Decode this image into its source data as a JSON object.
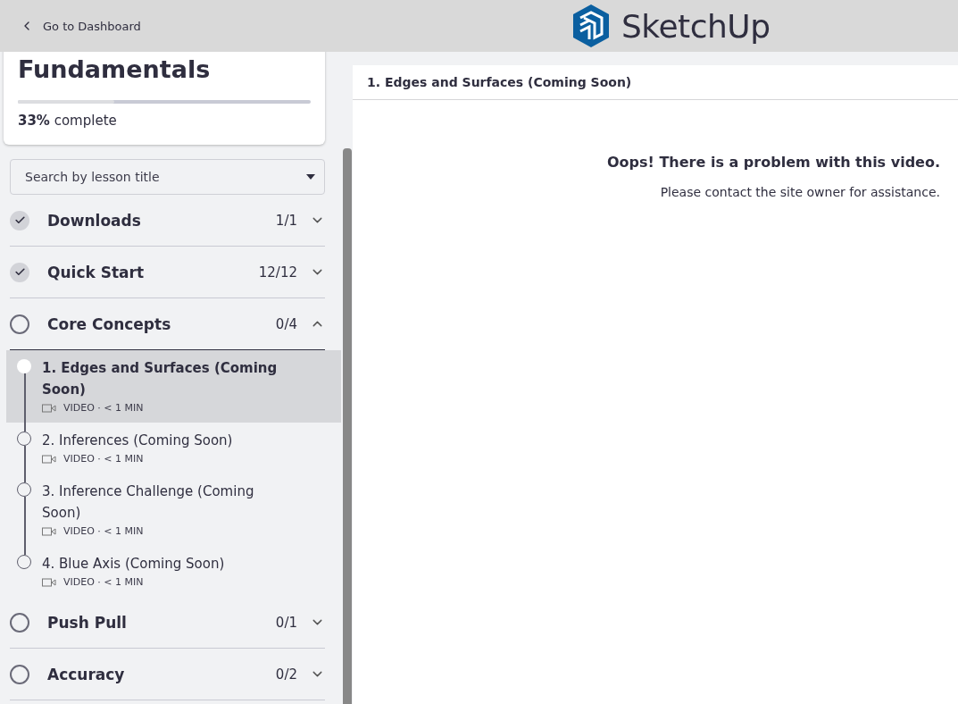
{
  "header": {
    "back_link": "Go to Dashboard",
    "brand": "SketchUp"
  },
  "course": {
    "title": "Fundamentals",
    "progress": {
      "level": 0.33,
      "percent": "33%",
      "label": "complete"
    }
  },
  "search": {
    "placeholder": "Search by lesson title"
  },
  "sections": [
    {
      "title": "Downloads",
      "count": "1/1",
      "checked": true,
      "expanded": false
    },
    {
      "title": "Quick Start",
      "count": "12/12",
      "checked": true,
      "expanded": false
    },
    {
      "title": "Core Concepts",
      "count": "0/4",
      "checked": false,
      "expanded": true,
      "lessons": [
        {
          "title": "1. Edges and Surfaces (Coming Soon)",
          "meta": "VIDEO · < 1 MIN",
          "selected": true
        },
        {
          "title": "2. Inferences (Coming Soon)",
          "meta": "VIDEO · < 1 MIN",
          "selected": false
        },
        {
          "title": "3. Inference Challenge (Coming Soon)",
          "meta": "VIDEO · < 1 MIN",
          "selected": false
        },
        {
          "title": "4. Blue Axis (Coming Soon)",
          "meta": "VIDEO · < 1 MIN",
          "selected": false
        }
      ]
    },
    {
      "title": "Push Pull",
      "count": "0/1",
      "checked": false,
      "expanded": false
    },
    {
      "title": "Accuracy",
      "count": "0/2",
      "checked": false,
      "expanded": false
    }
  ],
  "lesson_view": {
    "title": "1. Edges and Surfaces (Coming Soon)",
    "error_title": "Oops! There is a problem with this video.",
    "error_text": "Please contact the site owner for assistance."
  }
}
